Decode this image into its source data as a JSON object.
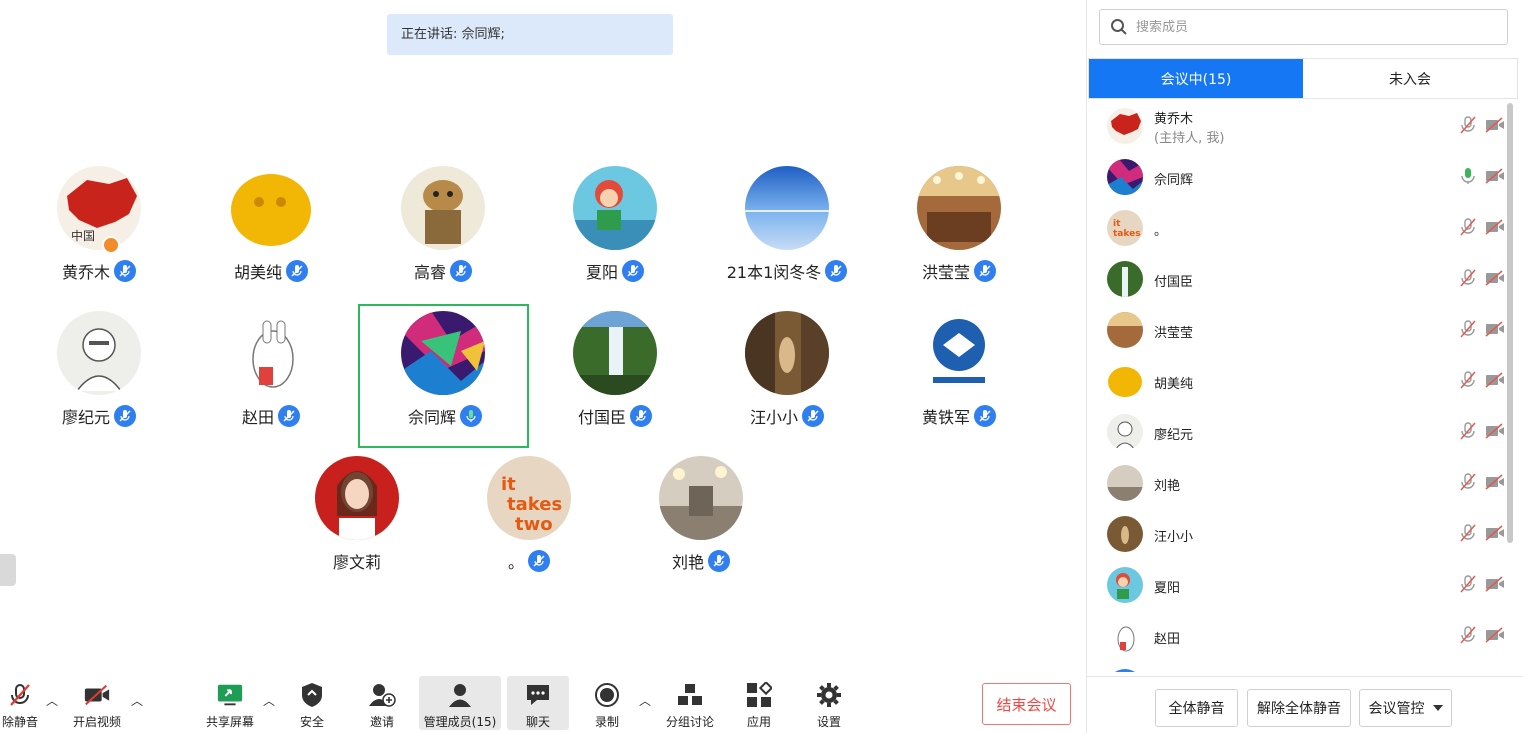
{
  "speaking": {
    "label": "正在讲话: 佘同辉;"
  },
  "colors": {
    "accent": "#1677f5",
    "speaker_border": "#2cb85c",
    "end_button": "#f04844",
    "mic_badge": "#2f7ff0",
    "mic_on": "#3cb55a"
  },
  "gallery": [
    {
      "name": "黄乔木",
      "avatar": "china-map-image",
      "host": true
    },
    {
      "name": "胡美纯",
      "avatar": "yellow-ball-image"
    },
    {
      "name": "高睿",
      "avatar": "cartoon-dog-image"
    },
    {
      "name": "夏阳",
      "avatar": "cartoon-girl-image"
    },
    {
      "name": "21本1闵冬冬",
      "avatar": "salt-flat-image"
    },
    {
      "name": "洪莹莹",
      "avatar": "banquet-hall-image"
    },
    {
      "name": "廖纪元",
      "avatar": "sketch-man-image"
    },
    {
      "name": "赵田",
      "avatar": "cartoon-rabbit-image"
    },
    {
      "name": "佘同辉",
      "avatar": "abstract-colorful-image",
      "speaking": true
    },
    {
      "name": "付国臣",
      "avatar": "waterfall-image"
    },
    {
      "name": "汪小小",
      "avatar": "street-image"
    },
    {
      "name": "黄铁军",
      "avatar": "school-logo-image"
    },
    {
      "name": "廖文莉",
      "avatar": "girl-portrait-image",
      "no_badge": true
    },
    {
      "name": "。",
      "avatar": "it-takes-two-image"
    },
    {
      "name": "刘艳",
      "avatar": "lobby-image"
    }
  ],
  "toolbar": {
    "mute": "除静音",
    "video": "开启视频",
    "share": "共享屏幕",
    "security": "安全",
    "invite": "邀请",
    "manage": "管理成员(15)",
    "chat": "聊天",
    "record": "录制",
    "breakout": "分组讨论",
    "apps": "应用",
    "settings": "设置",
    "end": "结束会议"
  },
  "panel": {
    "search_placeholder": "搜索成员",
    "tab_in": "会议中(15)",
    "tab_out": "未入会",
    "members": [
      {
        "name": "黄乔木",
        "sub": "(主持人, 我)",
        "avatar": "china-map-image"
      },
      {
        "name": "佘同辉",
        "avatar": "abstract-colorful-image",
        "mic_on": true
      },
      {
        "name": "。",
        "avatar": "it-takes-two-image"
      },
      {
        "name": "付国臣",
        "avatar": "waterfall-image"
      },
      {
        "name": "洪莹莹",
        "avatar": "banquet-hall-image"
      },
      {
        "name": "胡美纯",
        "avatar": "yellow-ball-image"
      },
      {
        "name": "廖纪元",
        "avatar": "sketch-man-image"
      },
      {
        "name": "刘艳",
        "avatar": "lobby-image"
      },
      {
        "name": "汪小小",
        "avatar": "street-image"
      },
      {
        "name": "夏阳",
        "avatar": "cartoon-girl-image"
      },
      {
        "name": "赵田",
        "avatar": "cartoon-rabbit-image"
      }
    ],
    "mute_all": "全体静音",
    "unmute_all": "解除全体静音",
    "control": "会议管控"
  }
}
